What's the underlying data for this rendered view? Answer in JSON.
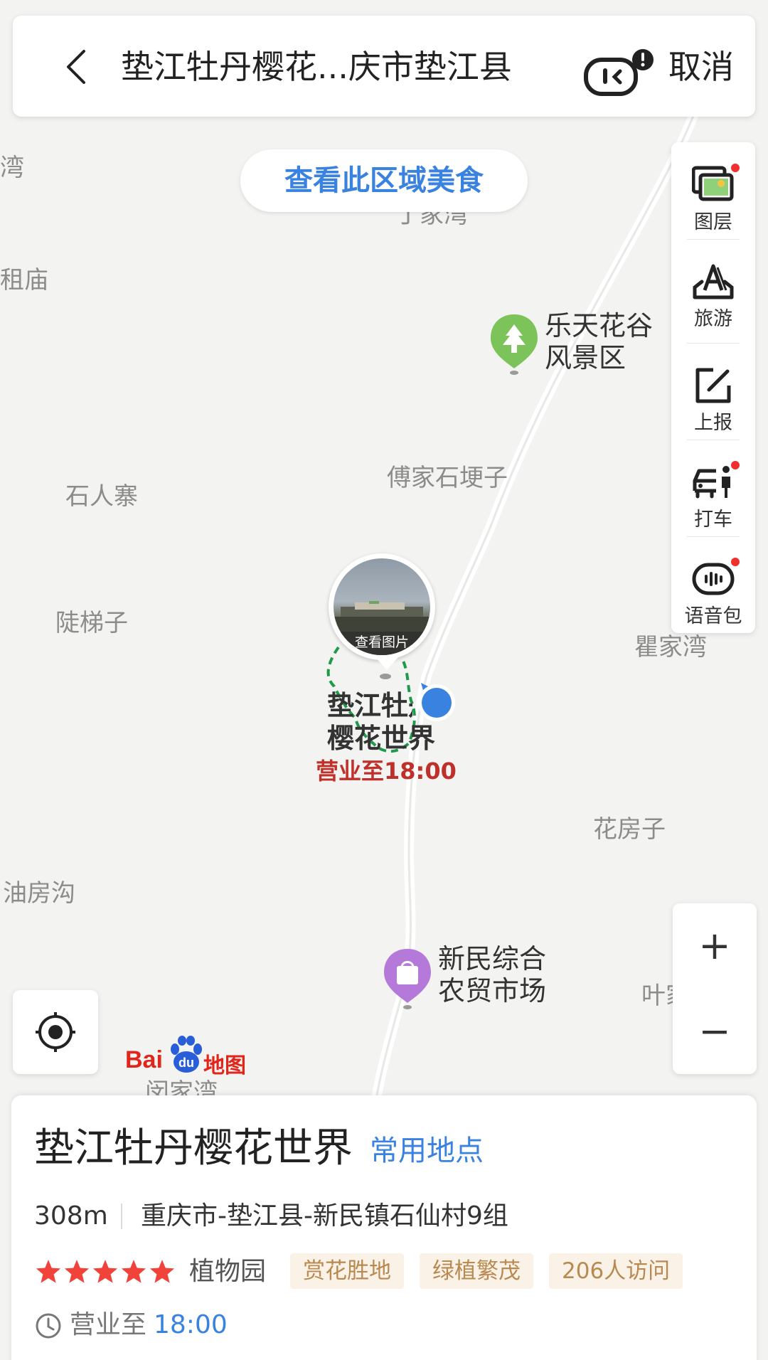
{
  "search_bar": {
    "query": "垫江牡丹樱花...庆市垫江县",
    "cancel_label": "取消"
  },
  "map": {
    "food_button_label": "查看此区域美食",
    "labels": [
      "湾",
      "租庙",
      "丁家湾",
      "石人寨",
      "傅家石埂子",
      "陡梯子",
      "瞿家湾",
      "花房子",
      "油房沟",
      "叶家",
      "闵家湾"
    ],
    "pois": [
      {
        "name_line1": "乐天花谷",
        "name_line2": "风景区",
        "icon": "tree-icon"
      },
      {
        "name_line1": "新民综合",
        "name_line2": "农贸市场",
        "icon": "shopping-bag-icon"
      }
    ],
    "selected_poi": {
      "name_line1": "垫江牡丹",
      "name_line2": "樱花世界",
      "photo_caption": "查看图片",
      "open_status": "营业至18:00"
    },
    "logo": {
      "bai": "Bai",
      "du": "du",
      "ditu": "地图"
    }
  },
  "toolbar": {
    "items": [
      {
        "label": "图层",
        "icon": "layers-icon",
        "badge": true
      },
      {
        "label": "旅游",
        "icon": "travel-icon",
        "badge": false
      },
      {
        "label": "上报",
        "icon": "report-icon",
        "badge": false
      },
      {
        "label": "打车",
        "icon": "taxi-icon",
        "badge": true
      },
      {
        "label": "语音包",
        "icon": "voice-pack-icon",
        "badge": true
      }
    ]
  },
  "zoom": {
    "in_label": "+",
    "out_label": "−"
  },
  "place_card": {
    "name": "垫江牡丹樱花世界",
    "fav_label": "常用地点",
    "distance": "308m",
    "address": "重庆市-垫江县-新民镇石仙村9组",
    "rating_stars": 5,
    "category": "植物园",
    "tags": [
      "赏花胜地",
      "绿植繁茂",
      "206人访问"
    ],
    "hours_prefix": "营业至",
    "hours_time": "18:00"
  },
  "colors": {
    "accent_blue": "#3a82e0",
    "star_red": "#f0443a",
    "badge_red": "#f0302f",
    "route_green": "#1f9a4a",
    "poi_green": "#7cc35a",
    "poi_purple": "#b57ad9"
  }
}
